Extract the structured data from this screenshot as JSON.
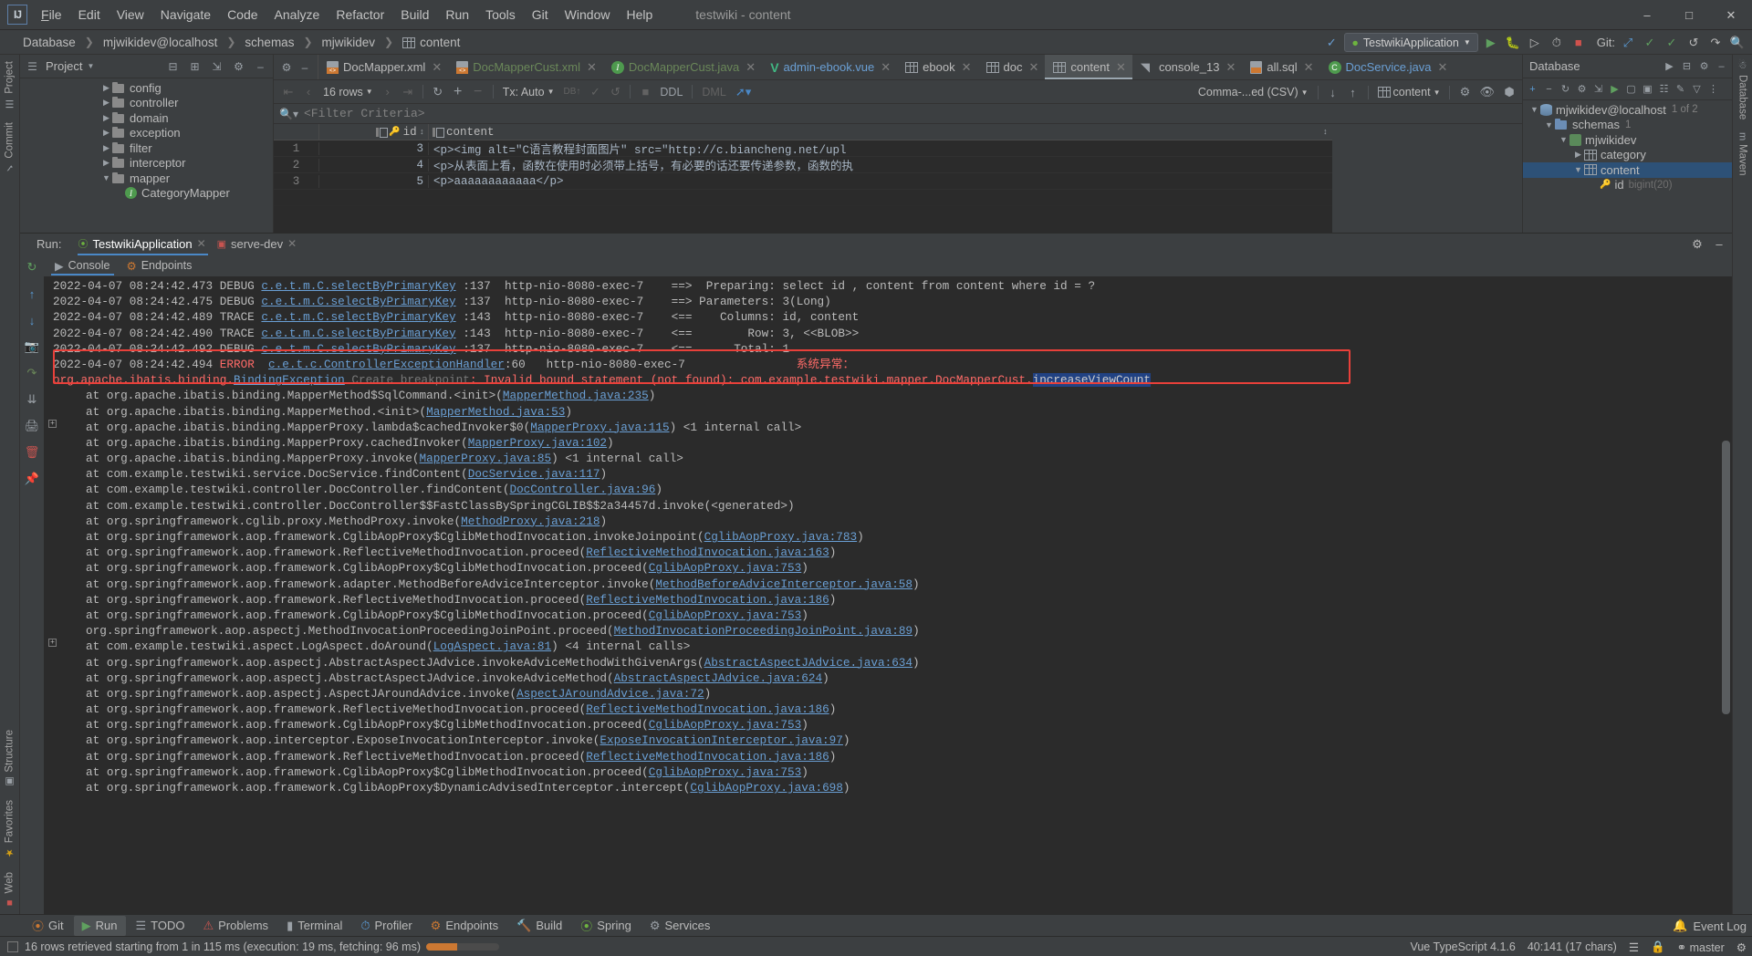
{
  "titlebar": {
    "logo": "IJ",
    "menu": [
      "File",
      "Edit",
      "View",
      "Navigate",
      "Code",
      "Analyze",
      "Refactor",
      "Build",
      "Run",
      "Tools",
      "Git",
      "Window",
      "Help"
    ],
    "window_title": "testwiki - content",
    "minimize": "–",
    "maximize": "☐",
    "close": "✕"
  },
  "navbar": {
    "breadcrumb": [
      "Database",
      "mjwikidev@localhost",
      "schemas",
      "mjwikidev",
      "content"
    ],
    "run_config": "TestwikiApplication",
    "git_label": "Git:",
    "search_icon": "search-icon"
  },
  "project": {
    "title": "Project",
    "tree": [
      {
        "label": "config",
        "indent": 1,
        "type": "folder"
      },
      {
        "label": "controller",
        "indent": 1,
        "type": "folder"
      },
      {
        "label": "domain",
        "indent": 1,
        "type": "folder"
      },
      {
        "label": "exception",
        "indent": 1,
        "type": "folder"
      },
      {
        "label": "filter",
        "indent": 1,
        "type": "folder"
      },
      {
        "label": "interceptor",
        "indent": 1,
        "type": "folder"
      },
      {
        "label": "mapper",
        "indent": 1,
        "type": "folder",
        "expanded": true
      },
      {
        "label": "CategoryMapper",
        "indent": 2,
        "type": "interface"
      }
    ]
  },
  "editor_tabs": [
    {
      "label": "DocMapper.xml",
      "icon": "xml-file-icon",
      "color": "grey",
      "active": false
    },
    {
      "label": "DocMapperCust.xml",
      "icon": "xml-file-icon",
      "color": "green",
      "active": false
    },
    {
      "label": "DocMapperCust.java",
      "icon": "java-interface-icon",
      "color": "green",
      "active": false
    },
    {
      "label": "admin-ebook.vue",
      "icon": "vue-file-icon",
      "color": "blue",
      "active": false
    },
    {
      "label": "ebook",
      "icon": "db-table-icon",
      "color": "grey",
      "active": false
    },
    {
      "label": "doc",
      "icon": "db-table-icon",
      "color": "grey",
      "active": false
    },
    {
      "label": "content",
      "icon": "db-table-icon",
      "color": "grey",
      "active": true
    },
    {
      "label": "console_13",
      "icon": "db-console-icon",
      "color": "grey",
      "active": false
    },
    {
      "label": "all.sql",
      "icon": "sql-file-icon",
      "color": "grey",
      "active": false
    },
    {
      "label": "DocService.java",
      "icon": "java-class-icon",
      "color": "blue",
      "active": false
    }
  ],
  "db_toolbar": {
    "first_page": "⏮",
    "prev_page": "‹",
    "rows_label": "16 rows",
    "next_page": "›",
    "last_page": "⏭",
    "refresh": "refresh-icon",
    "add_row": "+",
    "delete_row": "−",
    "tx_label": "Tx: Auto",
    "submit": "db-submit-icon",
    "commit": "✓",
    "rollback": "↺",
    "stop": "■",
    "ddl": "DDL",
    "dml": "DML",
    "export_label": "Comma-...ed (CSV)",
    "export_icon": "download-icon",
    "import_icon": "upload-icon",
    "table_label": "content",
    "settings_icon": "gear-icon",
    "view_icon": "eye-icon",
    "fullscreen_icon": "expand-icon"
  },
  "filter": {
    "icon": "search-filter-icon",
    "placeholder": "<Filter Criteria>"
  },
  "grid": {
    "columns": [
      "id",
      "content"
    ],
    "rows": [
      {
        "n": "1",
        "id": "3",
        "content": "<p><img alt=\"C语言教程封面图片\" src=\"http://c.biancheng.net/upl"
      },
      {
        "n": "2",
        "id": "4",
        "content": "<p>从表面上看，函数在使用时必须带上括号，有必要的话还要传递参数，函数的执"
      },
      {
        "n": "3",
        "id": "5",
        "content": "<p>aaaaaaaaaaaa</p>"
      }
    ]
  },
  "database_panel": {
    "title": "Database",
    "tree": [
      {
        "label": "mjwikidev@localhost",
        "indent": 0,
        "type": "datasource",
        "badge": "1 of 2",
        "expanded": true
      },
      {
        "label": "schemas",
        "indent": 1,
        "type": "folder",
        "badge": "1",
        "expanded": true
      },
      {
        "label": "mjwikidev",
        "indent": 2,
        "type": "schema",
        "expanded": true
      },
      {
        "label": "category",
        "indent": 3,
        "type": "table",
        "expanded": false
      },
      {
        "label": "content",
        "indent": 3,
        "type": "table",
        "expanded": true,
        "selected": true
      },
      {
        "label": "id",
        "indent": 4,
        "type": "column",
        "badge": "bigint(20)"
      }
    ]
  },
  "run_window": {
    "label": "Run:",
    "tabs": [
      {
        "label": "TestwikiApplication",
        "active": true,
        "icon": "spring-boot-icon"
      },
      {
        "label": "serve-dev",
        "active": false,
        "icon": "npm-icon"
      }
    ],
    "inner_tabs": [
      {
        "label": "Console",
        "active": true,
        "icon": "console-icon"
      },
      {
        "label": "Endpoints",
        "active": false,
        "icon": "endpoints-icon"
      }
    ],
    "settings_icon": "gear-icon",
    "minimize_icon": "minimize-icon"
  },
  "console": {
    "lines": [
      {
        "type": "log",
        "date": "2022-04-07 08:24:42.473",
        "level": "DEBUG",
        "logger": "c.e.t.m.C.selectByPrimaryKey",
        "line": ":137",
        "thread": "http-nio-8080-exec-7",
        "msg": "==>  Preparing: select id , content from content where id = ?"
      },
      {
        "type": "log",
        "date": "2022-04-07 08:24:42.475",
        "level": "DEBUG",
        "logger": "c.e.t.m.C.selectByPrimaryKey",
        "line": ":137",
        "thread": "http-nio-8080-exec-7",
        "msg": "==> Parameters: 3(Long)"
      },
      {
        "type": "log",
        "date": "2022-04-07 08:24:42.489",
        "level": "TRACE",
        "logger": "c.e.t.m.C.selectByPrimaryKey",
        "line": ":143",
        "thread": "http-nio-8080-exec-7",
        "msg": "<==    Columns: id, content"
      },
      {
        "type": "log",
        "date": "2022-04-07 08:24:42.490",
        "level": "TRACE",
        "logger": "c.e.t.m.C.selectByPrimaryKey",
        "line": ":143",
        "thread": "http-nio-8080-exec-7",
        "msg": "<==        Row: 3, <<BLOB>>"
      },
      {
        "type": "log",
        "date": "2022-04-07 08:24:42.492",
        "level": "DEBUG",
        "logger": "c.e.t.m.C.selectByPrimaryKey",
        "line": ":137",
        "thread": "http-nio-8080-exec-7",
        "msg": "<==      Total: 1"
      },
      {
        "type": "error_head",
        "date": "2022-04-07 08:24:42.494",
        "level": "ERROR",
        "logger": "c.e.t.c.ControllerExceptionHandler",
        "line": ":60",
        "thread": "http-nio-8080-exec-7",
        "msg": "系统异常："
      },
      {
        "type": "error_body",
        "prefix": "org.apache.ibatis.binding.",
        "link": "BindingException",
        "breakpoint": "Create breakpoint",
        "text": ": Invalid bound statement (not found): com.example.testwiki.mapper.DocMapperCust.",
        "selected": "increaseViewCount"
      },
      {
        "type": "stack",
        "text": "at org.apache.ibatis.binding.MapperMethod$SqlCommand.<init>(",
        "link": "MapperMethod.java:235",
        "tail": ")"
      },
      {
        "type": "stack",
        "text": "at org.apache.ibatis.binding.MapperMethod.<init>(",
        "link": "MapperMethod.java:53",
        "tail": ")"
      },
      {
        "type": "stack",
        "fold": "+",
        "text": "at org.apache.ibatis.binding.MapperProxy.lambda$cachedInvoker$0(",
        "link": "MapperProxy.java:115",
        "tail": ") <1 internal call>"
      },
      {
        "type": "stack",
        "text": "at org.apache.ibatis.binding.MapperProxy.cachedInvoker(",
        "link": "MapperProxy.java:102",
        "tail": ")"
      },
      {
        "type": "stack",
        "text": "at org.apache.ibatis.binding.MapperProxy.invoke(",
        "link": "MapperProxy.java:85",
        "tail": ") <1 internal call>"
      },
      {
        "type": "stack",
        "text": "at com.example.testwiki.service.DocService.findContent(",
        "link": "DocService.java:117",
        "tail": ")"
      },
      {
        "type": "stack",
        "text": "at com.example.testwiki.controller.DocController.findContent(",
        "link": "DocController.java:96",
        "tail": ")"
      },
      {
        "type": "stack",
        "text": "at com.example.testwiki.controller.DocController$$FastClassBySpringCGLIB$$2a34457d.invoke(<generated>)",
        "link": "",
        "tail": ""
      },
      {
        "type": "stack",
        "text": "at org.springframework.cglib.proxy.MethodProxy.invoke(",
        "link": "MethodProxy.java:218",
        "tail": ")"
      },
      {
        "type": "stack",
        "text": "at org.springframework.aop.framework.CglibAopProxy$CglibMethodInvocation.invokeJoinpoint(",
        "link": "CglibAopProxy.java:783",
        "tail": ")"
      },
      {
        "type": "stack",
        "text": "at org.springframework.aop.framework.ReflectiveMethodInvocation.proceed(",
        "link": "ReflectiveMethodInvocation.java:163",
        "tail": ")"
      },
      {
        "type": "stack",
        "text": "at org.springframework.aop.framework.CglibAopProxy$CglibMethodInvocation.proceed(",
        "link": "CglibAopProxy.java:753",
        "tail": ")"
      },
      {
        "type": "stack",
        "text": "at org.springframework.aop.framework.adapter.MethodBeforeAdviceInterceptor.invoke(",
        "link": "MethodBeforeAdviceInterceptor.java:58",
        "tail": ")"
      },
      {
        "type": "stack",
        "text": "at org.springframework.aop.framework.ReflectiveMethodInvocation.proceed(",
        "link": "ReflectiveMethodInvocation.java:186",
        "tail": ")"
      },
      {
        "type": "stack",
        "text": "at org.springframework.aop.framework.CglibAopProxy$CglibMethodInvocation.proceed(",
        "link": "CglibAopProxy.java:753",
        "tail": ")"
      },
      {
        "type": "stack",
        "text": "org.springframework.aop.aspectj.MethodInvocationProceedingJoinPoint.proceed(",
        "link": "MethodInvocationProceedingJoinPoint.java:89",
        "tail": ")"
      },
      {
        "type": "stack",
        "fold": "+",
        "text": "at com.example.testwiki.aspect.LogAspect.doAround(",
        "link": "LogAspect.java:81",
        "tail": ") <4 internal calls>"
      },
      {
        "type": "stack",
        "text": "at org.springframework.aop.aspectj.AbstractAspectJAdvice.invokeAdviceMethodWithGivenArgs(",
        "link": "AbstractAspectJAdvice.java:634",
        "tail": ")"
      },
      {
        "type": "stack",
        "text": "at org.springframework.aop.aspectj.AbstractAspectJAdvice.invokeAdviceMethod(",
        "link": "AbstractAspectJAdvice.java:624",
        "tail": ")"
      },
      {
        "type": "stack",
        "text": "at org.springframework.aop.aspectj.AspectJAroundAdvice.invoke(",
        "link": "AspectJAroundAdvice.java:72",
        "tail": ")"
      },
      {
        "type": "stack",
        "text": "at org.springframework.aop.framework.ReflectiveMethodInvocation.proceed(",
        "link": "ReflectiveMethodInvocation.java:186",
        "tail": ")"
      },
      {
        "type": "stack",
        "text": "at org.springframework.aop.framework.CglibAopProxy$CglibMethodInvocation.proceed(",
        "link": "CglibAopProxy.java:753",
        "tail": ")"
      },
      {
        "type": "stack",
        "text": "at org.springframework.aop.interceptor.ExposeInvocationInterceptor.invoke(",
        "link": "ExposeInvocationInterceptor.java:97",
        "tail": ")"
      },
      {
        "type": "stack",
        "text": "at org.springframework.aop.framework.ReflectiveMethodInvocation.proceed(",
        "link": "ReflectiveMethodInvocation.java:186",
        "tail": ")"
      },
      {
        "type": "stack",
        "text": "at org.springframework.aop.framework.CglibAopProxy$CglibMethodInvocation.proceed(",
        "link": "CglibAopProxy.java:753",
        "tail": ")"
      },
      {
        "type": "stack",
        "text": "at org.springframework.aop.framework.CglibAopProxy$DynamicAdvisedInterceptor.intercept(",
        "link": "CglibAopProxy.java:698",
        "tail": ")"
      }
    ]
  },
  "left_rail": {
    "top": [
      "Project",
      "Commit"
    ],
    "bottom": [
      "Structure",
      "Favorites",
      "Web"
    ]
  },
  "right_rail": {
    "items": [
      "Database",
      "Maven"
    ]
  },
  "bottom_bar": {
    "tabs": [
      {
        "label": "Git",
        "icon": "git-icon",
        "active": false
      },
      {
        "label": "Run",
        "icon": "run-icon",
        "active": true
      },
      {
        "label": "TODO",
        "icon": "todo-icon",
        "active": false
      },
      {
        "label": "Problems",
        "icon": "problems-icon",
        "active": false
      },
      {
        "label": "Terminal",
        "icon": "terminal-icon",
        "active": false
      },
      {
        "label": "Profiler",
        "icon": "profiler-icon",
        "active": false
      },
      {
        "label": "Endpoints",
        "icon": "endpoints-icon",
        "active": false
      },
      {
        "label": "Build",
        "icon": "build-icon",
        "active": false
      },
      {
        "label": "Spring",
        "icon": "spring-icon",
        "active": false
      },
      {
        "label": "Services",
        "icon": "services-icon",
        "active": false
      }
    ],
    "event_log": "Event Log",
    "event_log_icon": "bell-icon"
  },
  "statusbar": {
    "message": "16 rows retrieved starting from 1 in 115 ms (execution: 19 ms, fetching: 96 ms)",
    "progress_percent": 42,
    "right": {
      "framework": "Vue TypeScript 4.1.6",
      "caret": "40:141 (17 chars)",
      "branch": "master",
      "branch_icon": "branch-icon",
      "lock_icon": "lock-icon"
    }
  },
  "colors": {
    "accent_blue": "#4a88c7",
    "error_red": "#e8403a",
    "link_blue": "#6a9fd4",
    "green": "#6a8759",
    "bg_panel": "#3c3f41",
    "bg_editor": "#2b2b2b",
    "selection": "#214283"
  }
}
